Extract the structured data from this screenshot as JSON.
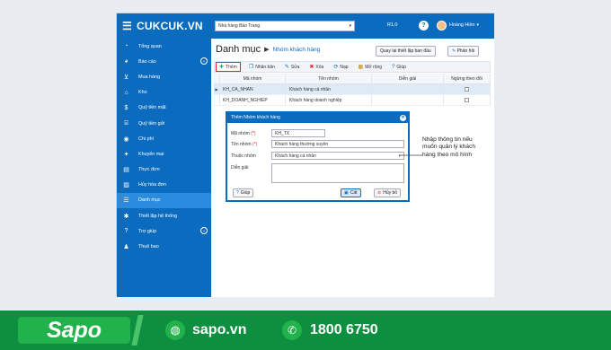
{
  "app": {
    "logo": "CUKCUK.VN"
  },
  "topbar": {
    "store": "Nhà hàng Bảo Trang",
    "version": "R1.0",
    "user": "Hoàng Hiền"
  },
  "sidebar": {
    "items": [
      {
        "label": "Tổng quan",
        "icon": "dashboard-icon"
      },
      {
        "label": "Báo cáo",
        "icon": "pie-chart-icon",
        "expand": "⌄"
      },
      {
        "label": "Mua hàng",
        "icon": "cart-icon"
      },
      {
        "label": "Kho",
        "icon": "warehouse-icon"
      },
      {
        "label": "Quỹ tiền mặt",
        "icon": "dollar-icon"
      },
      {
        "label": "Quỹ tiền gửi",
        "icon": "bank-icon"
      },
      {
        "label": "Chi phí",
        "icon": "expense-icon"
      },
      {
        "label": "Khuyến mại",
        "icon": "promotion-icon"
      },
      {
        "label": "Thực đơn",
        "icon": "menu-book-icon"
      },
      {
        "label": "Hủy hóa đơn",
        "icon": "cancel-invoice-icon"
      },
      {
        "label": "Danh mục",
        "icon": "list-icon",
        "active": true
      },
      {
        "label": "Thiết lập hệ thống",
        "icon": "settings-icon"
      },
      {
        "label": "Trợ giúp",
        "icon": "help-icon",
        "expand": "⌄"
      },
      {
        "label": "Thuê bao",
        "icon": "users-icon"
      }
    ]
  },
  "main": {
    "title": "Danh mục",
    "subtitle": "Nhóm khách hàng",
    "reset_btn": "Quay lại thiết lập ban đầu",
    "feedback_btn": "Phản hồi",
    "toolbar": [
      "Thêm",
      "Nhân bản",
      "Sửa",
      "Xóa",
      "Nạp",
      "Mở rộng",
      "Giúp"
    ]
  },
  "grid": {
    "headers": [
      "Mã nhóm",
      "Tên nhóm",
      "Diễn giải",
      "Ngừng theo dõi"
    ],
    "rows": [
      [
        "KH_CA_NHAN",
        "Khách hàng cá nhân",
        ""
      ],
      [
        "KH_DOANH_NGHIEP",
        "Khách hàng doanh nghiệp",
        ""
      ]
    ]
  },
  "dialog": {
    "title": "Thêm Nhóm khách hàng",
    "code_label": "Mã nhóm",
    "code_value": "KH_TX",
    "name_label": "Tên nhóm",
    "name_value": "Khách hàng thường xuyên",
    "parent_label": "Thuộc nhóm",
    "parent_value": "Khách hàng cá nhân",
    "desc_label": "Diễn giải",
    "required": "(*)",
    "help_btn": "Giúp",
    "save_btn": "Cất",
    "cancel_btn": "Hủy bỏ"
  },
  "note": "Nhập thông tin nếu muốn quản lý khách hàng theo mô hình",
  "footer": {
    "brand": "Sapo",
    "website": "sapo.vn",
    "phone": "1800 6750"
  }
}
